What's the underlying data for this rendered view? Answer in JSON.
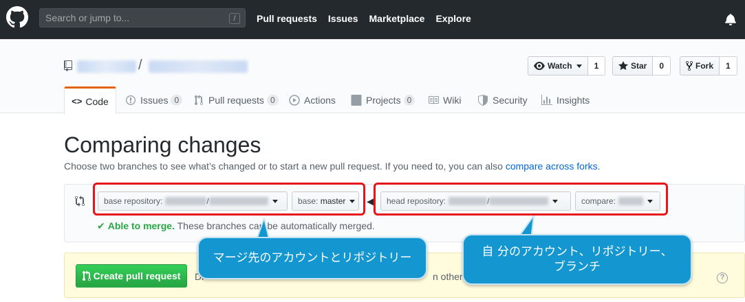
{
  "header": {
    "search_placeholder": "Search or jump to...",
    "search_shortcut": "/",
    "nav": [
      "Pull requests",
      "Issues",
      "Marketplace",
      "Explore"
    ]
  },
  "repo": {
    "separator": "/",
    "actions": {
      "watch_label": "Watch",
      "watch_count": "1",
      "star_label": "Star",
      "star_count": "0",
      "fork_label": "Fork",
      "fork_count": "1"
    }
  },
  "tabs": [
    {
      "label": "Code"
    },
    {
      "label": "Issues",
      "count": "0"
    },
    {
      "label": "Pull requests",
      "count": "0"
    },
    {
      "label": "Actions"
    },
    {
      "label": "Projects",
      "count": "0"
    },
    {
      "label": "Wiki"
    },
    {
      "label": "Security"
    },
    {
      "label": "Insights"
    }
  ],
  "compare": {
    "title": "Comparing changes",
    "desc_prefix": "Choose two branches to see what’s changed or to start a new pull request. If you need to, you can also ",
    "desc_link": "compare across forks",
    "desc_suffix": ".",
    "base_repo_label": "base repository:",
    "base_label": "base:",
    "base_value": "master",
    "head_repo_label": "head repository:",
    "compare_label": "compare:",
    "merge_ok": "Able to merge.",
    "merge_rest": "These branches can be automatically merged."
  },
  "create": {
    "button_label": "Create pull request",
    "text_left": "Di",
    "text_right": "n others."
  },
  "callouts": {
    "left": "マージ先のアカウントとリポジトリー",
    "right_line1": "自 分のアカウント、リポジトリー、",
    "right_line2": "ブランチ"
  },
  "colors": {
    "header_bg": "#24292e",
    "accent_tab": "#e36209",
    "link": "#0366d6",
    "success": "#28a745",
    "highlight_frame": "#e8141b",
    "callout_bg": "#1496d0"
  }
}
